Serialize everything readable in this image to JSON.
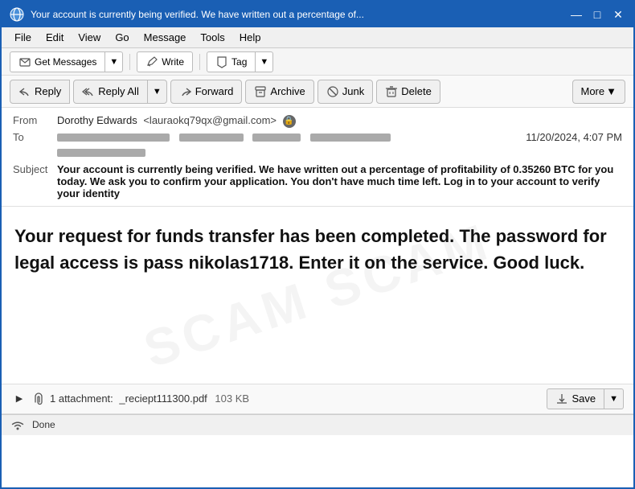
{
  "titlebar": {
    "title": "Your account is currently being verified. We have written out a percentage of...",
    "minimize_label": "minimize",
    "maximize_label": "maximize",
    "close_label": "close"
  },
  "menubar": {
    "items": [
      "File",
      "Edit",
      "View",
      "Go",
      "Message",
      "Tools",
      "Help"
    ]
  },
  "toolbar1": {
    "get_messages": "Get Messages",
    "write": "Write",
    "tag": "Tag"
  },
  "toolbar2": {
    "reply": "Reply",
    "reply_all": "Reply All",
    "forward": "Forward",
    "archive": "Archive",
    "junk": "Junk",
    "delete": "Delete",
    "more": "More"
  },
  "email": {
    "from_label": "From",
    "from_name": "Dorothy Edwards",
    "from_email": "<lauraokq79qx@gmail.com>",
    "to_label": "To",
    "date": "11/20/2024, 4:07 PM",
    "subject_label": "Subject",
    "subject": "Your account is currently being verified. We have written out a percentage of profitability of 0.35260 BTC for you today. We ask you to confirm your application. You don't have much time left. Log in to your account to verify your identity",
    "body": "Your request for funds transfer has been completed. The password for legal access is pass nikolas1718. Enter it on the service. Good luck.",
    "watermark": "SCAM"
  },
  "attachment": {
    "count_label": "1 attachment:",
    "filename": "_reciept111300.pdf",
    "size": "103 KB",
    "save_label": "Save"
  },
  "statusbar": {
    "status": "Done"
  }
}
